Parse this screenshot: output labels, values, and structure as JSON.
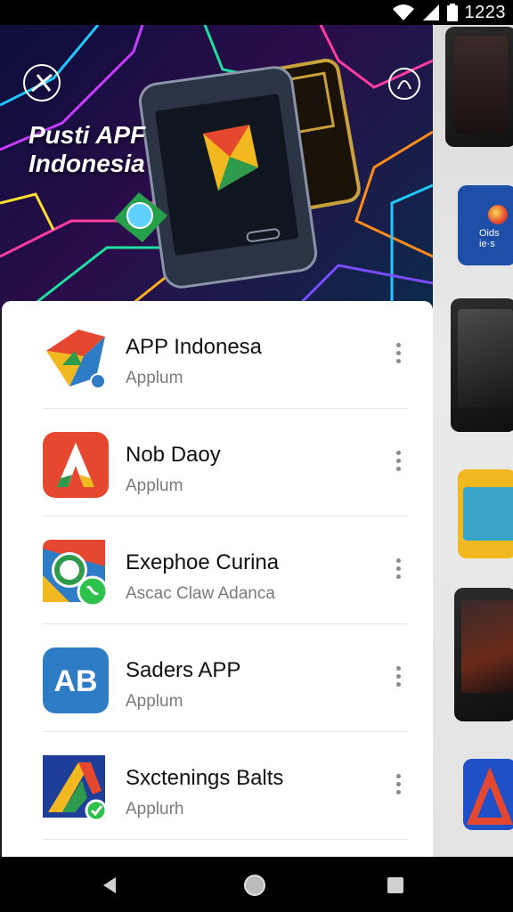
{
  "status": {
    "time": "1223"
  },
  "hero": {
    "line1": "Pusti APF",
    "line2": "Indonesia"
  },
  "apps": [
    {
      "name": "APP Indonesa",
      "sub": "Applum",
      "icon": "app-indonesa-logo-icon"
    },
    {
      "name": "Nob Daoy",
      "sub": "Applum",
      "icon": "letter-a-logo-icon"
    },
    {
      "name": "Exephoe Curina",
      "sub": "Ascac Claw Adanca",
      "icon": "chat-bubble-logo-icon"
    },
    {
      "name": "Saders APP",
      "sub": "Applum",
      "icon": "ab-logo-icon"
    },
    {
      "name": "Sxctenings Balts",
      "sub": "Applurh",
      "icon": "triangle-check-logo-icon"
    }
  ],
  "side_thumb": {
    "text": "Oids ie·s"
  },
  "colors": {
    "card": "#ffffff",
    "accent_red": "#e5482e",
    "accent_blue": "#2e7bc6"
  }
}
